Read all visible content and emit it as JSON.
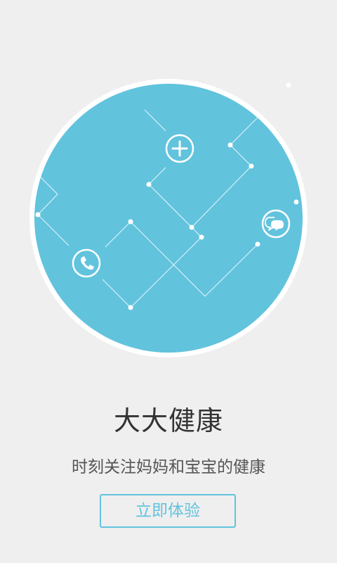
{
  "colors": {
    "background": "#efefef",
    "circle_fill": "#62c3dd",
    "circle_ring": "#ffffff",
    "accent": "#62c3dd",
    "title_text": "#333333",
    "subtitle_text": "#555555"
  },
  "hero": {
    "icons": [
      "plus-icon",
      "chat-bubbles-icon",
      "phone-icon"
    ]
  },
  "intro": {
    "title": "大大健康",
    "subtitle": "时刻关注妈妈和宝宝的健康",
    "cta_label": "立即体验"
  }
}
